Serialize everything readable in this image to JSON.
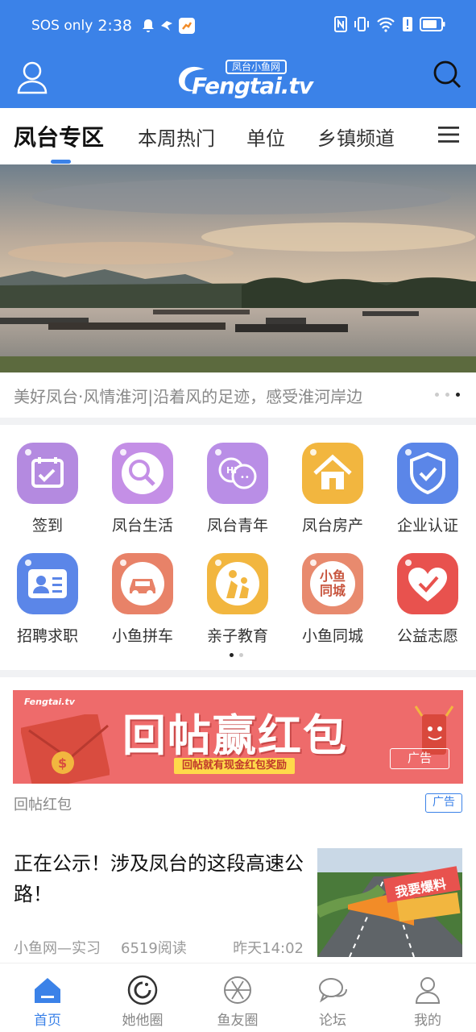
{
  "status_bar": {
    "carrier": "SOS only",
    "time": "2:38"
  },
  "header": {
    "logo_cn": "凤台小鱼网",
    "logo_en": "Fengtai.tv"
  },
  "tabs": [
    {
      "label": "凤台专区",
      "active": true
    },
    {
      "label": "本周热门",
      "active": false
    },
    {
      "label": "单位",
      "active": false
    },
    {
      "label": "乡镇频道",
      "active": false
    }
  ],
  "banner": {
    "caption": "美好凤台·风情淮河|沿着风的足迹，感受淮河岸边",
    "page_count": 3,
    "active_page": 3
  },
  "grid": {
    "items": [
      {
        "label": "签到",
        "icon": "calendar-check-icon",
        "color": "#b48ae0"
      },
      {
        "label": "凤台生活",
        "icon": "magnifier-icon",
        "color": "#c48fe6"
      },
      {
        "label": "凤台青年",
        "icon": "chat-bubbles-icon",
        "color": "#b98ee6"
      },
      {
        "label": "凤台房产",
        "icon": "house-icon",
        "color": "#f2b63f"
      },
      {
        "label": "企业认证",
        "icon": "shield-check-icon",
        "color": "#5b86e8"
      },
      {
        "label": "招聘求职",
        "icon": "id-card-icon",
        "color": "#5b86e8"
      },
      {
        "label": "小鱼拼车",
        "icon": "car-icon",
        "color": "#e88268"
      },
      {
        "label": "亲子教育",
        "icon": "parent-child-icon",
        "color": "#f2b63f"
      },
      {
        "label": "小鱼同城",
        "icon": "same-city-icon",
        "color": "#e88a6e",
        "glyph_text": "小鱼同城"
      },
      {
        "label": "公益志愿",
        "icon": "heart-hand-icon",
        "color": "#e8524e"
      }
    ],
    "page_count": 2,
    "active_page": 1
  },
  "ad": {
    "brand": "Fengtai.tv",
    "headline": "回帖赢红包",
    "sub": "回帖就有现金红包奖励",
    "inner_tag": "广告",
    "title": "回帖红包",
    "tag": "广告",
    "color": "#ee6b6b"
  },
  "article": {
    "title": "正在公示！涉及凤台的这段高速公路！",
    "source": "小鱼网—实习",
    "reads": "6519阅读",
    "time": "昨天14:02",
    "thumb_badge": "我要爆料"
  },
  "bottom_nav": [
    {
      "label": "首页",
      "icon": "home-icon",
      "active": true
    },
    {
      "label": "她他圈",
      "icon": "circle-icon",
      "active": false
    },
    {
      "label": "鱼友圈",
      "icon": "aperture-icon",
      "active": false
    },
    {
      "label": "论坛",
      "icon": "chat-icon",
      "active": false
    },
    {
      "label": "我的",
      "icon": "person-icon",
      "active": false
    }
  ],
  "colors": {
    "brand_blue": "#3b82e8"
  }
}
